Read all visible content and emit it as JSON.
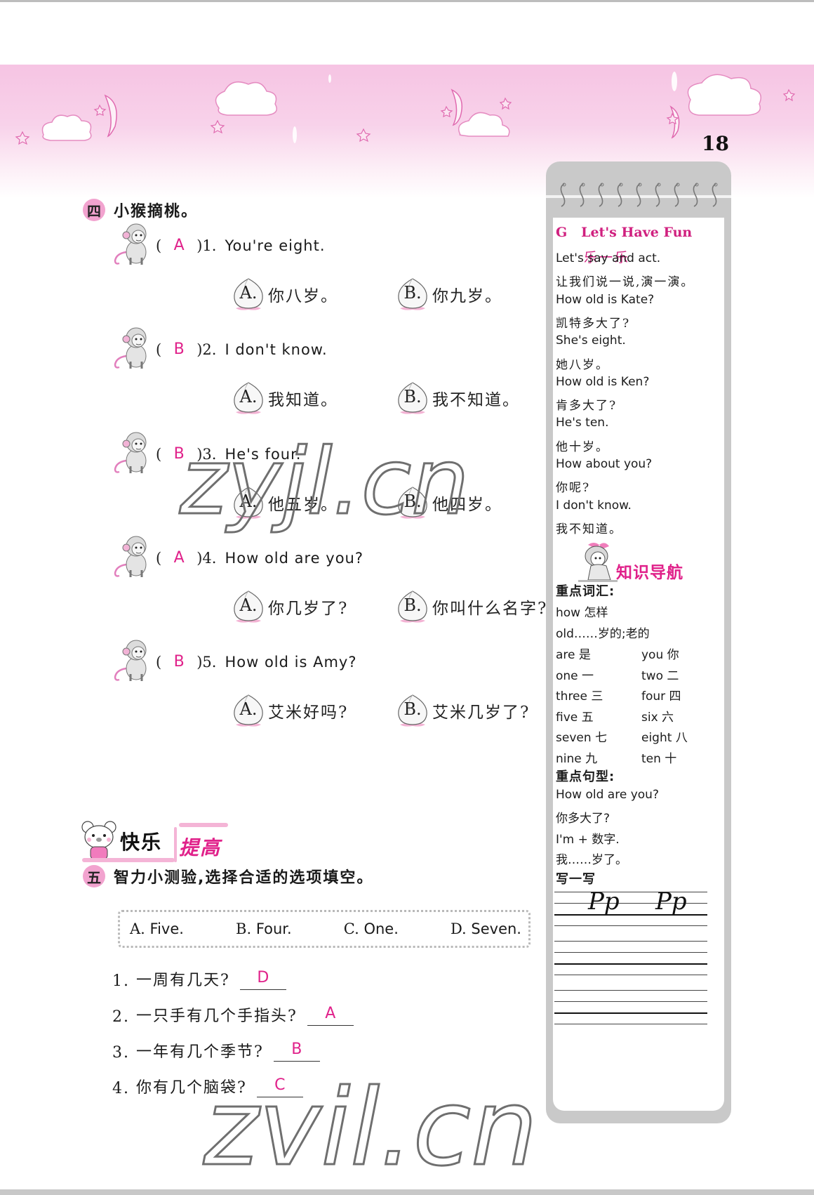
{
  "page": {
    "number": "18",
    "accent_color": "#e0218a",
    "badge_color": "#f2a3cf"
  },
  "section4": {
    "badge": "四",
    "title": "小猴摘桃。",
    "questions": [
      {
        "answer": "A",
        "num": "1.",
        "text": "You're eight.",
        "options": [
          {
            "letter": "A.",
            "text": "你八岁。"
          },
          {
            "letter": "B.",
            "text": "你九岁。"
          }
        ]
      },
      {
        "answer": "B",
        "num": "2.",
        "text": "I don't know.",
        "options": [
          {
            "letter": "A.",
            "text": "我知道。"
          },
          {
            "letter": "B.",
            "text": "我不知道。"
          }
        ]
      },
      {
        "answer": "B",
        "num": "3.",
        "text": "He's four.",
        "options": [
          {
            "letter": "A.",
            "text": "他五岁。"
          },
          {
            "letter": "B.",
            "text": "他四岁。"
          }
        ]
      },
      {
        "answer": "A",
        "num": "4.",
        "text": "How old are you?",
        "options": [
          {
            "letter": "A.",
            "text": "你几岁了?"
          },
          {
            "letter": "B.",
            "text": "你叫什么名字?"
          }
        ]
      },
      {
        "answer": "B",
        "num": "5.",
        "text": "How old is Amy?",
        "options": [
          {
            "letter": "A.",
            "text": "艾米好吗?"
          },
          {
            "letter": "B.",
            "text": "艾米几岁了?"
          }
        ]
      }
    ]
  },
  "happy_improve": {
    "part1": "快乐",
    "part2": "提高"
  },
  "section5": {
    "badge": "五",
    "title": "智力小测验,选择合适的选项填空。",
    "choices": [
      {
        "letter": "A.",
        "text": "Five."
      },
      {
        "letter": "B.",
        "text": "Four."
      },
      {
        "letter": "C.",
        "text": "One."
      },
      {
        "letter": "D.",
        "text": "Seven."
      }
    ],
    "items": [
      {
        "num": "1.",
        "text": "一周有几天?",
        "answer": "D"
      },
      {
        "num": "2.",
        "text": "一只手有几个手指头?",
        "answer": "A"
      },
      {
        "num": "3.",
        "text": "一年有几个季节?",
        "answer": "B"
      },
      {
        "num": "4.",
        "text": "你有几个脑袋?",
        "answer": "C"
      }
    ]
  },
  "sidebar": {
    "heading_letter": "G",
    "heading_title": "Let's Have Fun",
    "heading_cn": "乐一乐",
    "dialogue": [
      "Let's say and act.",
      "让我们说一说,演一演。",
      "How old is Kate?",
      "凯特多大了?",
      "She's eight.",
      "她八岁。",
      "How old is Ken?",
      "肯多大了?",
      "He's ten.",
      "他十岁。",
      "How about you?",
      "你呢?",
      "I don't know.",
      "我不知道。"
    ],
    "nav_title": "知识导航",
    "vocab_heading": "重点词汇:",
    "vocab_single": [
      "how 怎样",
      "old……岁的;老的"
    ],
    "vocab_pairs": [
      [
        "are 是",
        "you 你"
      ],
      [
        "one 一",
        "two 二"
      ],
      [
        "three 三",
        "four 四"
      ],
      [
        "five 五",
        "six 六"
      ],
      [
        "seven 七",
        "eight 八"
      ],
      [
        "nine 九",
        "ten 十"
      ]
    ],
    "sentence_heading": "重点句型:",
    "sentences": [
      "How old are you?",
      "你多大了?",
      "I'm + 数字.",
      "我……岁了。"
    ],
    "write_heading": "写一写",
    "write_sample": [
      "Pp",
      "Pp"
    ]
  },
  "watermarks": [
    "zyjl.cn",
    "zvil.cn"
  ]
}
